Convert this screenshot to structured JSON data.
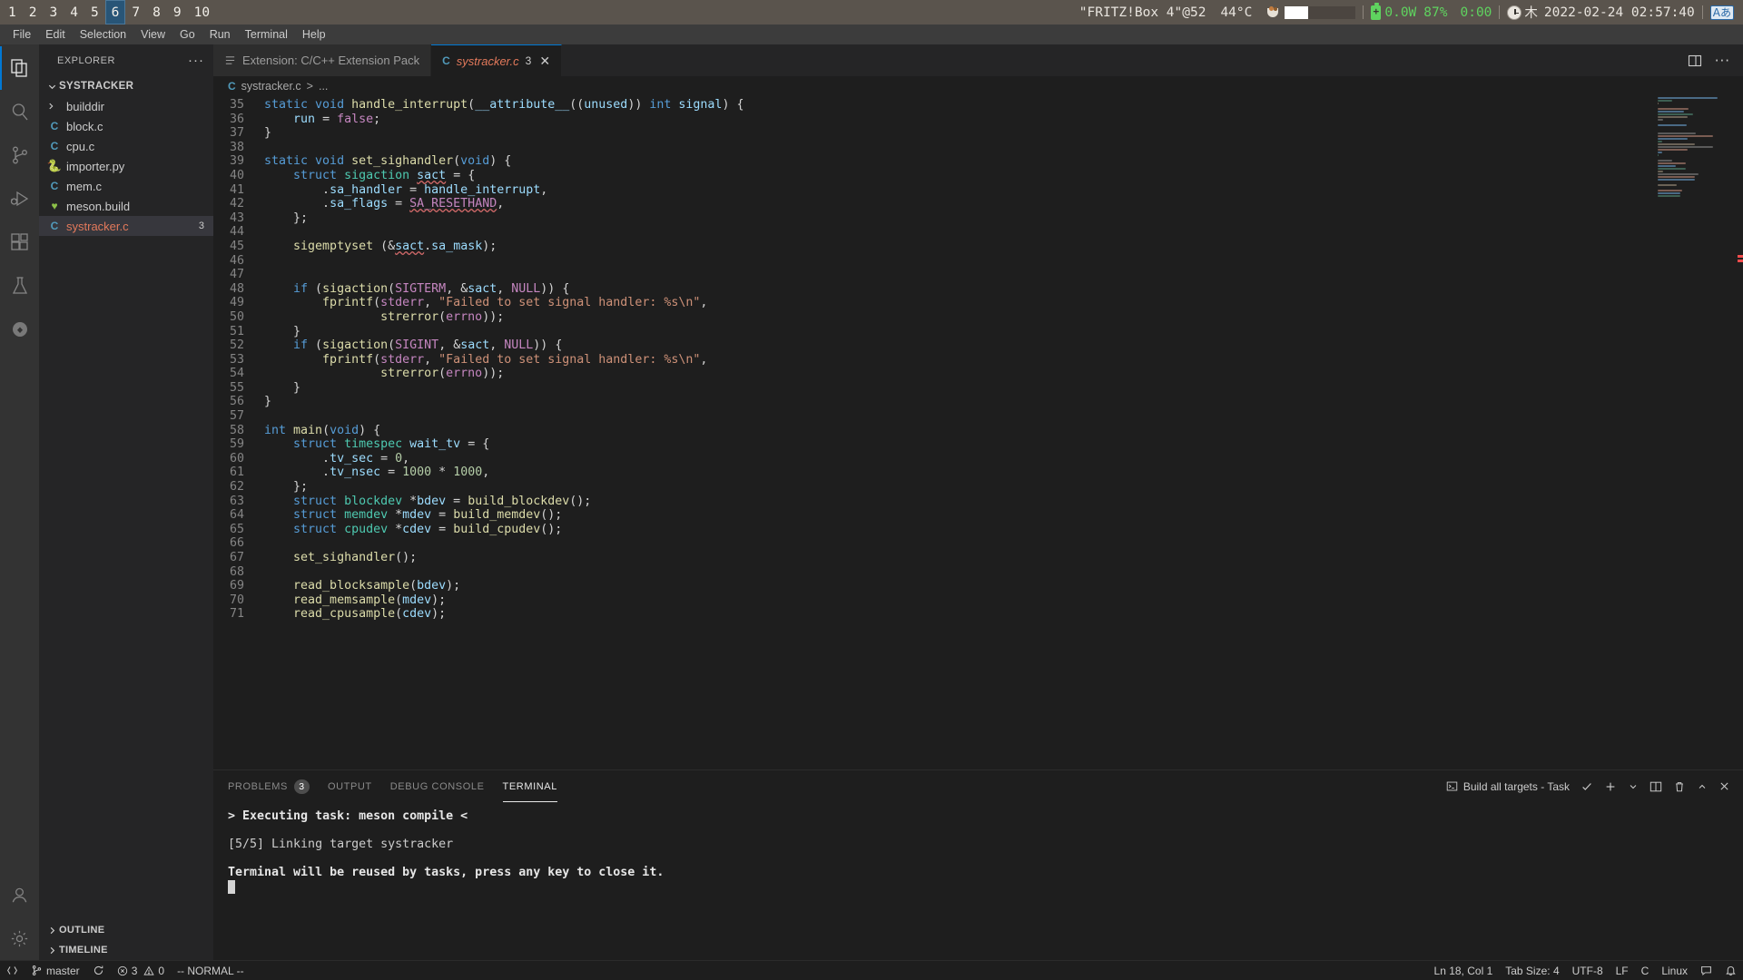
{
  "wm": {
    "workspaces": [
      "1",
      "2",
      "3",
      "4",
      "5",
      "6",
      "7",
      "8",
      "9",
      "10"
    ],
    "active_workspace": "6",
    "window_title": "\"FRITZ!Box 4\"@52",
    "temperature": "44°C",
    "power": "0.0W",
    "battery": "87%",
    "battery_time": "0:00",
    "weekday": "木",
    "datetime": "2022-02-24 02:57:40",
    "ime": "Aあ",
    "accent": "#285577",
    "bar_bg": "#5a544d",
    "green": "#5fd35f"
  },
  "menubar": {
    "items": [
      "File",
      "Edit",
      "Selection",
      "View",
      "Go",
      "Run",
      "Terminal",
      "Help"
    ]
  },
  "activitybar": {
    "items": [
      {
        "name": "explorer",
        "icon": "files-icon",
        "active": true
      },
      {
        "name": "search",
        "icon": "search-icon",
        "active": false
      },
      {
        "name": "source-control",
        "icon": "source-control-icon",
        "active": false
      },
      {
        "name": "run-and-debug",
        "icon": "run-debug-icon",
        "active": false
      },
      {
        "name": "extensions",
        "icon": "extensions-icon",
        "active": false
      },
      {
        "name": "testing",
        "icon": "beaker-icon",
        "active": false
      },
      {
        "name": "remote-explorer",
        "icon": "shield-icon",
        "active": false
      }
    ],
    "bottom": [
      {
        "name": "accounts",
        "icon": "account-icon"
      },
      {
        "name": "manage",
        "icon": "gear-icon"
      }
    ]
  },
  "sidebar": {
    "title": "EXPLORER",
    "more_actions": "···",
    "root_folder": "SYSTRACKER",
    "items": [
      {
        "label": "builddir",
        "type": "folder",
        "icon": "chevron-right-icon",
        "badge": ""
      },
      {
        "label": "block.c",
        "type": "c",
        "icon": "c-file-icon",
        "badge": ""
      },
      {
        "label": "cpu.c",
        "type": "c",
        "icon": "c-file-icon",
        "badge": ""
      },
      {
        "label": "importer.py",
        "type": "py",
        "icon": "python-file-icon",
        "badge": ""
      },
      {
        "label": "mem.c",
        "type": "c",
        "icon": "c-file-icon",
        "badge": ""
      },
      {
        "label": "meson.build",
        "type": "meson",
        "icon": "meson-file-icon",
        "badge": ""
      },
      {
        "label": "systracker.c",
        "type": "c",
        "icon": "c-file-icon",
        "badge": "3",
        "selected": true
      }
    ],
    "sections": [
      "OUTLINE",
      "TIMELINE"
    ]
  },
  "tabs": [
    {
      "label": "Extension: C/C++ Extension Pack",
      "icon": "extension-icon",
      "active": false,
      "badge": "",
      "dirty": false
    },
    {
      "label": "systracker.c",
      "icon": "c-file-icon",
      "active": true,
      "badge": "3",
      "dirty": true,
      "close": "✕"
    }
  ],
  "editor_actions": [
    "split-editor-icon",
    "more-actions-icon"
  ],
  "breadcrumb": {
    "icon": "c-file-icon",
    "file": "systracker.c",
    "separator": ">",
    "rest": "..."
  },
  "code": {
    "first_line": 35,
    "lines": [
      {
        "n": 35,
        "tokens": [
          {
            "t": "static ",
            "c": "kw"
          },
          {
            "t": "void ",
            "c": "kw"
          },
          {
            "t": "handle_interrupt",
            "c": "fn"
          },
          {
            "t": "(",
            "c": "pl"
          },
          {
            "t": "__attribute__",
            "c": "id"
          },
          {
            "t": "((",
            "c": "pl"
          },
          {
            "t": "unused",
            "c": "id"
          },
          {
            "t": ")) ",
            "c": "pl"
          },
          {
            "t": "int ",
            "c": "kw"
          },
          {
            "t": "signal",
            "c": "id"
          },
          {
            "t": ") {",
            "c": "pl"
          }
        ]
      },
      {
        "n": 36,
        "tokens": [
          {
            "t": "    ",
            "c": "pl"
          },
          {
            "t": "run",
            "c": "id"
          },
          {
            "t": " = ",
            "c": "pl"
          },
          {
            "t": "false",
            "c": "cn"
          },
          {
            "t": ";",
            "c": "pl"
          }
        ]
      },
      {
        "n": 37,
        "tokens": [
          {
            "t": "}",
            "c": "pl"
          }
        ]
      },
      {
        "n": 38,
        "tokens": []
      },
      {
        "n": 39,
        "tokens": [
          {
            "t": "static ",
            "c": "kw"
          },
          {
            "t": "void ",
            "c": "kw"
          },
          {
            "t": "set_sighandler",
            "c": "fn"
          },
          {
            "t": "(",
            "c": "pl"
          },
          {
            "t": "void",
            "c": "kw"
          },
          {
            "t": ") {",
            "c": "pl"
          }
        ]
      },
      {
        "n": 40,
        "tokens": [
          {
            "t": "    ",
            "c": "pl"
          },
          {
            "t": "struct ",
            "c": "kw"
          },
          {
            "t": "sigaction",
            "c": "ty"
          },
          {
            "t": " ",
            "c": "pl"
          },
          {
            "t": "sact",
            "c": "sq"
          },
          {
            "t": " = {",
            "c": "pl"
          }
        ]
      },
      {
        "n": 41,
        "tokens": [
          {
            "t": "        .",
            "c": "pl"
          },
          {
            "t": "sa_handler",
            "c": "id"
          },
          {
            "t": " = ",
            "c": "pl"
          },
          {
            "t": "handle_interrupt",
            "c": "id"
          },
          {
            "t": ",",
            "c": "pl"
          }
        ]
      },
      {
        "n": 42,
        "tokens": [
          {
            "t": "        .",
            "c": "pl"
          },
          {
            "t": "sa_flags",
            "c": "id"
          },
          {
            "t": " = ",
            "c": "pl"
          },
          {
            "t": "SA_RESETHAND",
            "c": "sqc"
          },
          {
            "t": ",",
            "c": "pl"
          }
        ]
      },
      {
        "n": 43,
        "tokens": [
          {
            "t": "    };",
            "c": "pl"
          }
        ]
      },
      {
        "n": 44,
        "tokens": []
      },
      {
        "n": 45,
        "tokens": [
          {
            "t": "    ",
            "c": "pl"
          },
          {
            "t": "sigemptyset",
            "c": "fn"
          },
          {
            "t": " (&",
            "c": "pl"
          },
          {
            "t": "sact",
            "c": "sq"
          },
          {
            "t": ".",
            "c": "pl"
          },
          {
            "t": "sa_mask",
            "c": "id"
          },
          {
            "t": ");",
            "c": "pl"
          }
        ]
      },
      {
        "n": 46,
        "tokens": []
      },
      {
        "n": 47,
        "tokens": []
      },
      {
        "n": 48,
        "tokens": [
          {
            "t": "    ",
            "c": "pl"
          },
          {
            "t": "if",
            "c": "kw"
          },
          {
            "t": " (",
            "c": "pl"
          },
          {
            "t": "sigaction",
            "c": "fn"
          },
          {
            "t": "(",
            "c": "pl"
          },
          {
            "t": "SIGTERM",
            "c": "cn"
          },
          {
            "t": ", &",
            "c": "pl"
          },
          {
            "t": "sact",
            "c": "id"
          },
          {
            "t": ", ",
            "c": "pl"
          },
          {
            "t": "NULL",
            "c": "cn"
          },
          {
            "t": ")) {",
            "c": "pl"
          }
        ]
      },
      {
        "n": 49,
        "tokens": [
          {
            "t": "        ",
            "c": "pl"
          },
          {
            "t": "fprintf",
            "c": "fn"
          },
          {
            "t": "(",
            "c": "pl"
          },
          {
            "t": "stderr",
            "c": "cn"
          },
          {
            "t": ", ",
            "c": "pl"
          },
          {
            "t": "\"Failed to set signal handler: %s\\n\"",
            "c": "st"
          },
          {
            "t": ",",
            "c": "pl"
          }
        ]
      },
      {
        "n": 50,
        "tokens": [
          {
            "t": "                ",
            "c": "pl"
          },
          {
            "t": "strerror",
            "c": "fn"
          },
          {
            "t": "(",
            "c": "pl"
          },
          {
            "t": "errno",
            "c": "cn"
          },
          {
            "t": "));",
            "c": "pl"
          }
        ]
      },
      {
        "n": 51,
        "tokens": [
          {
            "t": "    }",
            "c": "pl"
          }
        ]
      },
      {
        "n": 52,
        "tokens": [
          {
            "t": "    ",
            "c": "pl"
          },
          {
            "t": "if",
            "c": "kw"
          },
          {
            "t": " (",
            "c": "pl"
          },
          {
            "t": "sigaction",
            "c": "fn"
          },
          {
            "t": "(",
            "c": "pl"
          },
          {
            "t": "SIGINT",
            "c": "cn"
          },
          {
            "t": ", &",
            "c": "pl"
          },
          {
            "t": "sact",
            "c": "id"
          },
          {
            "t": ", ",
            "c": "pl"
          },
          {
            "t": "NULL",
            "c": "cn"
          },
          {
            "t": ")) {",
            "c": "pl"
          }
        ]
      },
      {
        "n": 53,
        "tokens": [
          {
            "t": "        ",
            "c": "pl"
          },
          {
            "t": "fprintf",
            "c": "fn"
          },
          {
            "t": "(",
            "c": "pl"
          },
          {
            "t": "stderr",
            "c": "cn"
          },
          {
            "t": ", ",
            "c": "pl"
          },
          {
            "t": "\"Failed to set signal handler: %s\\n\"",
            "c": "st"
          },
          {
            "t": ",",
            "c": "pl"
          }
        ]
      },
      {
        "n": 54,
        "tokens": [
          {
            "t": "                ",
            "c": "pl"
          },
          {
            "t": "strerror",
            "c": "fn"
          },
          {
            "t": "(",
            "c": "pl"
          },
          {
            "t": "errno",
            "c": "cn"
          },
          {
            "t": "));",
            "c": "pl"
          }
        ]
      },
      {
        "n": 55,
        "tokens": [
          {
            "t": "    }",
            "c": "pl"
          }
        ]
      },
      {
        "n": 56,
        "tokens": [
          {
            "t": "}",
            "c": "pl"
          }
        ]
      },
      {
        "n": 57,
        "tokens": []
      },
      {
        "n": 58,
        "tokens": [
          {
            "t": "int ",
            "c": "kw"
          },
          {
            "t": "main",
            "c": "fn"
          },
          {
            "t": "(",
            "c": "pl"
          },
          {
            "t": "void",
            "c": "kw"
          },
          {
            "t": ") {",
            "c": "pl"
          }
        ]
      },
      {
        "n": 59,
        "tokens": [
          {
            "t": "    ",
            "c": "pl"
          },
          {
            "t": "struct ",
            "c": "kw"
          },
          {
            "t": "timespec",
            "c": "ty"
          },
          {
            "t": " ",
            "c": "pl"
          },
          {
            "t": "wait_tv",
            "c": "id"
          },
          {
            "t": " = {",
            "c": "pl"
          }
        ]
      },
      {
        "n": 60,
        "tokens": [
          {
            "t": "        .",
            "c": "pl"
          },
          {
            "t": "tv_sec",
            "c": "id"
          },
          {
            "t": " = ",
            "c": "pl"
          },
          {
            "t": "0",
            "c": "nm"
          },
          {
            "t": ",",
            "c": "pl"
          }
        ]
      },
      {
        "n": 61,
        "tokens": [
          {
            "t": "        .",
            "c": "pl"
          },
          {
            "t": "tv_nsec",
            "c": "id"
          },
          {
            "t": " = ",
            "c": "pl"
          },
          {
            "t": "1000",
            "c": "nm"
          },
          {
            "t": " * ",
            "c": "pl"
          },
          {
            "t": "1000",
            "c": "nm"
          },
          {
            "t": ",",
            "c": "pl"
          }
        ]
      },
      {
        "n": 62,
        "tokens": [
          {
            "t": "    };",
            "c": "pl"
          }
        ]
      },
      {
        "n": 63,
        "tokens": [
          {
            "t": "    ",
            "c": "pl"
          },
          {
            "t": "struct ",
            "c": "kw"
          },
          {
            "t": "blockdev",
            "c": "ty"
          },
          {
            "t": " *",
            "c": "pl"
          },
          {
            "t": "bdev",
            "c": "id"
          },
          {
            "t": " = ",
            "c": "pl"
          },
          {
            "t": "build_blockdev",
            "c": "fn"
          },
          {
            "t": "();",
            "c": "pl"
          }
        ]
      },
      {
        "n": 64,
        "tokens": [
          {
            "t": "    ",
            "c": "pl"
          },
          {
            "t": "struct ",
            "c": "kw"
          },
          {
            "t": "memdev",
            "c": "ty"
          },
          {
            "t": " *",
            "c": "pl"
          },
          {
            "t": "mdev",
            "c": "id"
          },
          {
            "t": " = ",
            "c": "pl"
          },
          {
            "t": "build_memdev",
            "c": "fn"
          },
          {
            "t": "();",
            "c": "pl"
          }
        ]
      },
      {
        "n": 65,
        "tokens": [
          {
            "t": "    ",
            "c": "pl"
          },
          {
            "t": "struct ",
            "c": "kw"
          },
          {
            "t": "cpudev",
            "c": "ty"
          },
          {
            "t": " *",
            "c": "pl"
          },
          {
            "t": "cdev",
            "c": "id"
          },
          {
            "t": " = ",
            "c": "pl"
          },
          {
            "t": "build_cpudev",
            "c": "fn"
          },
          {
            "t": "();",
            "c": "pl"
          }
        ]
      },
      {
        "n": 66,
        "tokens": []
      },
      {
        "n": 67,
        "tokens": [
          {
            "t": "    ",
            "c": "pl"
          },
          {
            "t": "set_sighandler",
            "c": "fn"
          },
          {
            "t": "();",
            "c": "pl"
          }
        ]
      },
      {
        "n": 68,
        "tokens": []
      },
      {
        "n": 69,
        "tokens": [
          {
            "t": "    ",
            "c": "pl"
          },
          {
            "t": "read_blocksample",
            "c": "fn"
          },
          {
            "t": "(",
            "c": "pl"
          },
          {
            "t": "bdev",
            "c": "id"
          },
          {
            "t": ");",
            "c": "pl"
          }
        ]
      },
      {
        "n": 70,
        "tokens": [
          {
            "t": "    ",
            "c": "pl"
          },
          {
            "t": "read_memsample",
            "c": "fn"
          },
          {
            "t": "(",
            "c": "pl"
          },
          {
            "t": "mdev",
            "c": "id"
          },
          {
            "t": ");",
            "c": "pl"
          }
        ]
      },
      {
        "n": 71,
        "tokens": [
          {
            "t": "    ",
            "c": "pl"
          },
          {
            "t": "read_cpusample",
            "c": "fn"
          },
          {
            "t": "(",
            "c": "pl"
          },
          {
            "t": "cdev",
            "c": "id"
          },
          {
            "t": ");",
            "c": "pl"
          }
        ]
      }
    ]
  },
  "panel": {
    "tabs": [
      {
        "label": "PROBLEMS",
        "badge": "3",
        "active": false
      },
      {
        "label": "OUTPUT",
        "badge": "",
        "active": false
      },
      {
        "label": "DEBUG CONSOLE",
        "badge": "",
        "active": false
      },
      {
        "label": "TERMINAL",
        "badge": "",
        "active": true
      }
    ],
    "task_label": "Build all targets - Task",
    "actions": [
      "terminal-icon",
      "check-icon",
      "add-icon",
      "chevron-down-icon",
      "split-icon",
      "trash-icon",
      "chevron-up-icon",
      "close-icon"
    ],
    "terminal_lines": [
      {
        "text": "> Executing task: meson compile <",
        "bold": true
      },
      {
        "text": "",
        "bold": false
      },
      {
        "text": "[5/5] Linking target systracker",
        "bold": false
      },
      {
        "text": "",
        "bold": false
      },
      {
        "text": "Terminal will be reused by tasks, press any key to close it.",
        "bold": true
      }
    ]
  },
  "statusbar": {
    "left": [
      {
        "name": "remote-indicator",
        "icon": "remote-icon",
        "label": ""
      },
      {
        "name": "branch",
        "icon": "source-control-icon",
        "label": "master"
      },
      {
        "name": "sync",
        "icon": "sync-icon",
        "label": ""
      },
      {
        "name": "problems",
        "icon": "error-warning-icon",
        "label": "3  0"
      },
      {
        "name": "vim-mode",
        "icon": "",
        "label": "-- NORMAL --"
      }
    ],
    "right": [
      {
        "name": "cursor-position",
        "label": "Ln 18, Col 1"
      },
      {
        "name": "tab-size",
        "label": "Tab Size: 4"
      },
      {
        "name": "encoding",
        "label": "UTF-8"
      },
      {
        "name": "eol",
        "label": "LF"
      },
      {
        "name": "language-mode",
        "label": "C"
      },
      {
        "name": "platform",
        "label": "Linux"
      },
      {
        "name": "feedback",
        "label": ""
      },
      {
        "name": "notifications",
        "label": ""
      }
    ],
    "error_count": "3",
    "warning_count": "0"
  }
}
